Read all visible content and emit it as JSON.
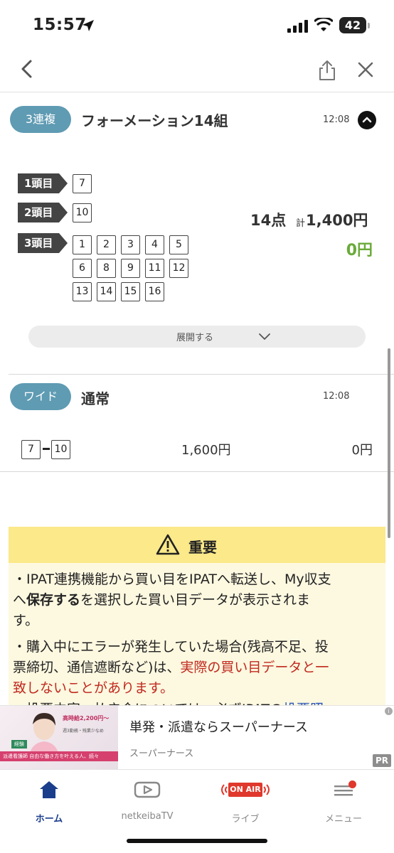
{
  "status_bar": {
    "time": "15:57",
    "battery": "42"
  },
  "colors": {
    "bet_type_badge": "#5f9bb3",
    "payout_green": "#6aaa3a",
    "notice_header": "#fbe98a",
    "notice_bg": "#fdf8e0",
    "alert_red": "#c0281e",
    "link_blue": "#2a56b8",
    "active_tab": "#1a3e8c"
  },
  "nav": {
    "icons": [
      "chevron-left-icon",
      "share-icon",
      "close-icon"
    ]
  },
  "bets": [
    {
      "type": "3連複",
      "title": "フォーメーション14組",
      "time": "12:08",
      "positions": [
        {
          "label": "1頭目",
          "numbers": [
            "7"
          ]
        },
        {
          "label": "2頭目",
          "numbers": [
            "10"
          ]
        },
        {
          "label": "3頭目",
          "numbers": [
            "1",
            "2",
            "3",
            "4",
            "5",
            "6",
            "8",
            "9",
            "11",
            "12",
            "13",
            "14",
            "15",
            "16"
          ]
        }
      ],
      "count": "14点",
      "total_prefix": "計",
      "total": "1,400円",
      "payout": "0円",
      "expand_label": "展開する"
    },
    {
      "type": "ワイド",
      "title": "通常",
      "time": "12:08",
      "combo": [
        "7",
        "10"
      ],
      "amount": "1,600円",
      "payout": "0円"
    }
  ],
  "notice": {
    "title": "重要",
    "p1_a": "・IPAT連携機能から買い目をIPATへ転送し、My収支",
    "p1_b_pre": "へ",
    "p1_b_bold": "保存する",
    "p1_b_post": "を選択した買い目データが表示されま",
    "p1_c": "す。",
    "p2_a": "・購入中にエラーが発生していた場合(残高不足、投",
    "p2_b_pre": "票締切、通信遮断など)は、",
    "p2_b_red": "実際の買い目データと一",
    "p2_c_red": "致しないことがあります。",
    "p3_pre": "・投票内容・払戻金については、必ずIPATの",
    "p3_link": "投票照"
  },
  "ad": {
    "headline": "単発・派遣ならスーパーナース",
    "sponsor": "スーパーナース",
    "pr": "PR",
    "info": "i",
    "image_text_1": "高時給2,200円〜",
    "image_text_2": "週3勤務・残業少なめ",
    "image_tag": "経験",
    "image_strip": "派遣看護師 自由な働き方を叶える人、続々"
  },
  "tabs": [
    {
      "label": "ホーム",
      "icon": "home-icon",
      "active": true
    },
    {
      "label": "netkeibaTV",
      "icon": "tv-play-icon",
      "active": false
    },
    {
      "label": "ライブ",
      "icon": "on-air-icon",
      "badge": "ON AIR",
      "active": false
    },
    {
      "label": "メニュー",
      "icon": "menu-icon",
      "active": false
    }
  ]
}
